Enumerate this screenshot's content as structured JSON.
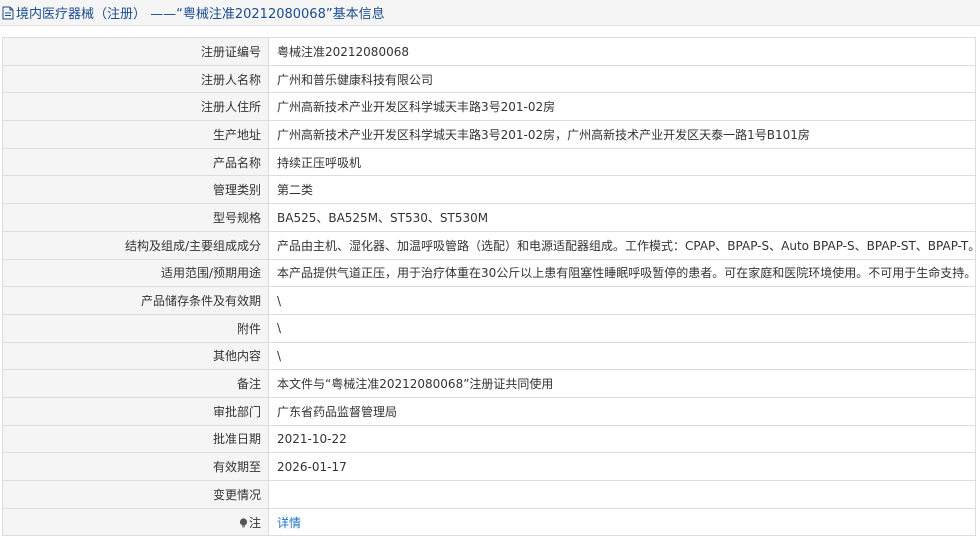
{
  "header": {
    "title": "境内医疗器械（注册） ——“粤械注准20212080068”基本信息",
    "icon": "document-icon"
  },
  "rows": [
    {
      "label": "注册证编号",
      "value": "粤械注准20212080068"
    },
    {
      "label": "注册人名称",
      "value": "广州和普乐健康科技有限公司"
    },
    {
      "label": "注册人住所",
      "value": "广州高新技术产业开发区科学城天丰路3号201-02房"
    },
    {
      "label": "生产地址",
      "value": "广州高新技术产业开发区科学城天丰路3号201-02房，广州高新技术产业开发区天泰一路1号B101房"
    },
    {
      "label": "产品名称",
      "value": "持续正压呼吸机"
    },
    {
      "label": "管理类别",
      "value": "第二类"
    },
    {
      "label": "型号规格",
      "value": "BA525、BA525M、ST530、ST530M"
    },
    {
      "label": "结构及组成/主要组成成分",
      "value": "产品由主机、湿化器、加温呼吸管路（选配）和电源适配器组成。工作模式：CPAP、BPAP-S、Auto BPAP-S、BPAP-ST、BPAP-T。"
    },
    {
      "label": "适用范围/预期用途",
      "value": "本产品提供气道正压，用于治疗体重在30公斤以上患有阻塞性睡眠呼吸暂停的患者。可在家庭和医院环境使用。不可用于生命支持。"
    },
    {
      "label": "产品储存条件及有效期",
      "value": "\\"
    },
    {
      "label": "附件",
      "value": "\\"
    },
    {
      "label": "其他内容",
      "value": "\\"
    },
    {
      "label": "备注",
      "value": "本文件与“粤械注准20212080068”注册证共同使用"
    },
    {
      "label": "审批部门",
      "value": "广东省药品监督管理局"
    },
    {
      "label": "批准日期",
      "value": "2021-10-22"
    },
    {
      "label": "有效期至",
      "value": "2026-01-17"
    },
    {
      "label": "变更情况",
      "value": ""
    }
  ],
  "note_row": {
    "label": "注",
    "icon": "lightbulb-icon",
    "link_text": "详情"
  },
  "colors": {
    "title": "#1a4d8f",
    "link": "#1a73c8",
    "label_bg": "#f5f5f5",
    "border": "#dddddd"
  }
}
